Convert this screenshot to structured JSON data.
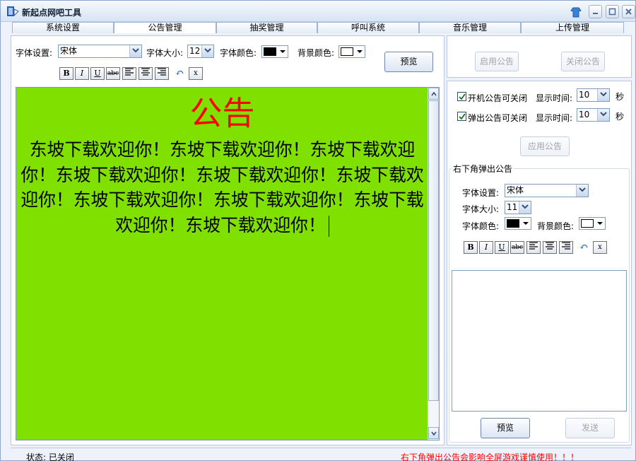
{
  "window": {
    "title": "新起点网吧工具"
  },
  "tabs": [
    {
      "label": "系统设置"
    },
    {
      "label": "公告管理"
    },
    {
      "label": "抽奖管理"
    },
    {
      "label": "呼叫系统"
    },
    {
      "label": "音乐管理"
    },
    {
      "label": "上传管理"
    }
  ],
  "active_tab": "公告管理",
  "toolbar": {
    "font_label": "字体设置:",
    "font_value": "宋体",
    "size_label": "字体大小:",
    "size_value": "12",
    "color_label": "字体颜色:",
    "color_value": "#000000",
    "bg_label": "背景颜色:",
    "bg_value": "#ffffff",
    "preview_label": "预览"
  },
  "format_buttons": [
    {
      "name": "bold",
      "glyph": "B"
    },
    {
      "name": "italic",
      "glyph": "I"
    },
    {
      "name": "underline",
      "glyph": "U"
    },
    {
      "name": "strikethrough",
      "glyph": "abc"
    },
    {
      "name": "align-left",
      "glyph": "≡"
    },
    {
      "name": "align-center",
      "glyph": "≡"
    },
    {
      "name": "align-right",
      "glyph": "≡"
    },
    {
      "name": "undo",
      "glyph": "↶"
    },
    {
      "name": "clear-format",
      "glyph": "x"
    }
  ],
  "editor": {
    "background": "#80e000",
    "title": "公告",
    "title_color": "#ff0000",
    "body": "东坡下载欢迎你！东坡下载欢迎你！东坡下载欢迎你！东坡下载欢迎你！东坡下载欢迎你！东坡下载欢迎你！东坡下载欢迎你！东坡下载欢迎你！东坡下载欢迎你！东坡下载欢迎你！"
  },
  "right_panel": {
    "enable_label": "启用公告",
    "disable_label": "关闭公告",
    "startup_check_label": "开机公告可关闭",
    "startup_checked": true,
    "startup_time_label": "显示时间:",
    "startup_time_value": "10",
    "startup_unit": "秒",
    "popup_check_label": "弹出公告可关闭",
    "popup_checked": true,
    "popup_time_label": "显示时间:",
    "popup_time_value": "10",
    "popup_unit": "秒",
    "apply_label": "应用公告"
  },
  "popup_group": {
    "title": "右下角弹出公告",
    "font_label": "字体设置:",
    "font_value": "宋体",
    "size_label": "字体大小:",
    "size_value": "11",
    "color_label": "字体颜色:",
    "color_value": "#000000",
    "bg_label": "背景颜色:",
    "bg_value": "#ffffff",
    "preview_label": "预览",
    "send_label": "发送"
  },
  "status": {
    "left": "状态: 已关闭",
    "warning": "右下角弹出公告会影响全屏游戏谨慎使用！！！"
  },
  "colors": {
    "accent": "#1c5180",
    "warning": "#ff0000",
    "editor_bg": "#80e000"
  }
}
